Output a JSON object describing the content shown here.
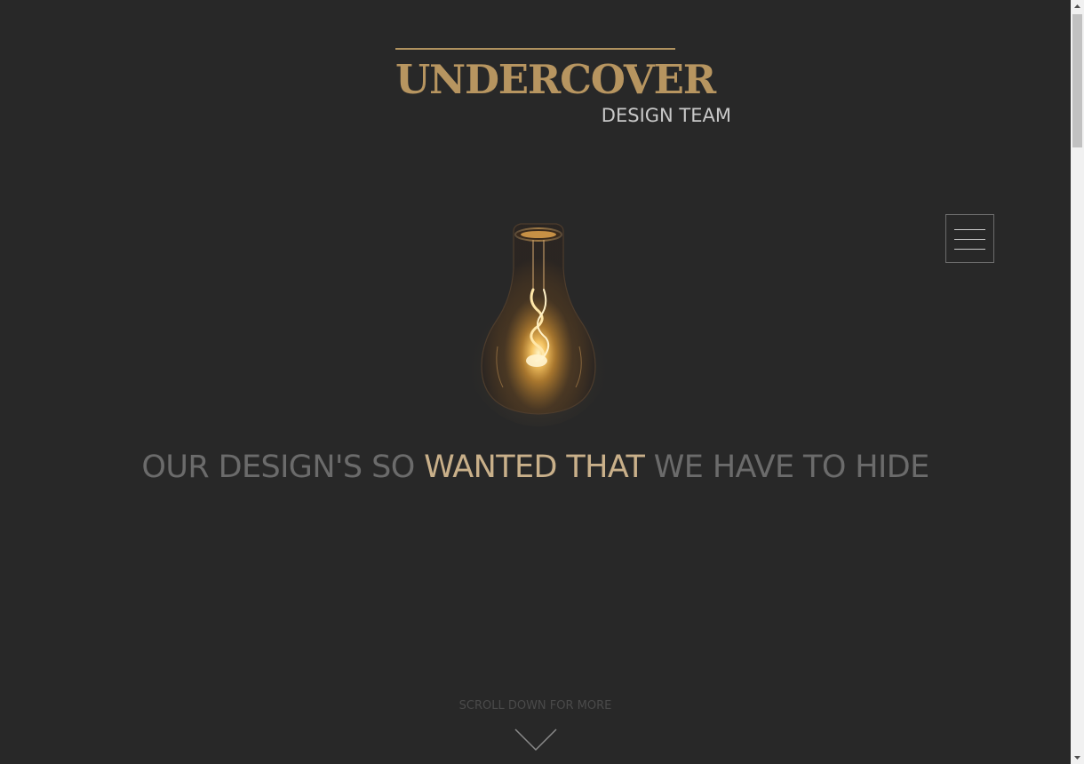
{
  "header": {
    "logo_title": "UNDERCOVER",
    "logo_subtitle": "DESIGN TEAM"
  },
  "menu": {
    "icon": "hamburger-menu-icon"
  },
  "hero": {
    "image": "light-bulb",
    "headline_part1": "OUR DESIGN'S SO ",
    "headline_highlight": "WANTED THAT",
    "headline_part2": " WE HAVE TO HIDE"
  },
  "scroll": {
    "label": "SCROLL DOWN FOR MORE",
    "icon": "chevron-down-icon"
  },
  "colors": {
    "background": "#282828",
    "gold": "#b79560",
    "headline_highlight": "#c9b08a",
    "headline_dim": "#6b6b6b",
    "subtitle": "#c8c8c8"
  }
}
